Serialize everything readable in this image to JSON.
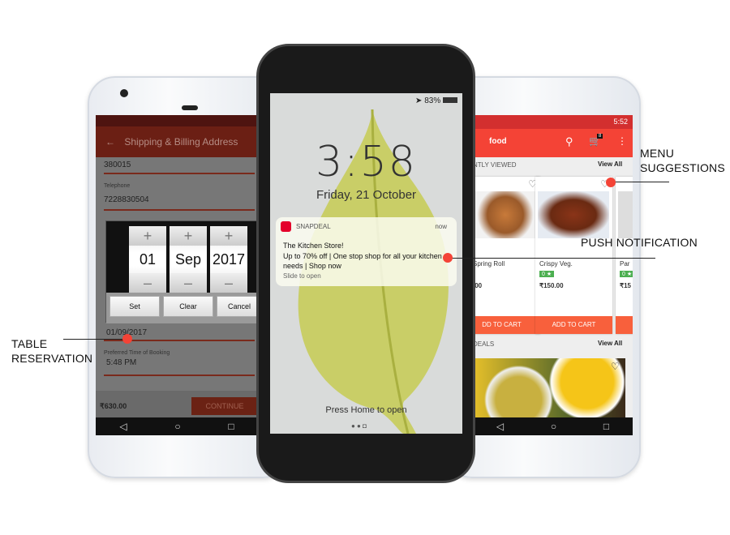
{
  "left_phone": {
    "header": {
      "title": "Shipping & Billing Address",
      "back_icon": "arrow-left-icon"
    },
    "fields": [
      {
        "label": "",
        "value": "380015"
      },
      {
        "label": "Telephone",
        "value": "7228830504"
      }
    ],
    "date_picker": {
      "day": "01",
      "month": "Sep",
      "year": "2017",
      "buttons": {
        "set": "Set",
        "clear": "Clear",
        "cancel": "Cancel"
      }
    },
    "date_value": "01/09/2017",
    "time_label": "Preferred Time of Booking",
    "time_value": "5:48 PM",
    "total": "₹630.00",
    "continue_label": "CONTINUE",
    "header_color": "#6b1f14"
  },
  "center_phone": {
    "status": {
      "battery": "83%"
    },
    "clock": "3:58",
    "date": "Friday, 21 October",
    "notification": {
      "app": "SNAPDEAL",
      "time": "now",
      "title": "The Kitchen Store!",
      "body": "Up to 70% off | One stop shop for all your kitchen needs | Shop now",
      "hint": "Slide to open"
    },
    "press_home": "Press Home to open"
  },
  "right_phone": {
    "status": {
      "time": "5:52"
    },
    "header": {
      "title": "food",
      "cart_count": "8"
    },
    "recent": {
      "title": "NTLY VIEWED",
      "view_all": "View All"
    },
    "cards": [
      {
        "name": "Spring Roll",
        "price": ".00",
        "button": "DD TO CART"
      },
      {
        "name": "Crispy Veg.",
        "rating": "0 ★",
        "price": "₹150.00",
        "button": "ADD TO CART"
      },
      {
        "name": "Par",
        "rating": "0 ★",
        "price": "₹15"
      }
    ],
    "deals": {
      "title": "DEALS",
      "view_all": "View All"
    },
    "accent": "#f44336"
  },
  "annotations": {
    "menu": [
      "MENU",
      "SUGGESTIONS"
    ],
    "push": "PUSH NOTIFICATION",
    "table": [
      "TABLE",
      "RESERVATION"
    ]
  }
}
